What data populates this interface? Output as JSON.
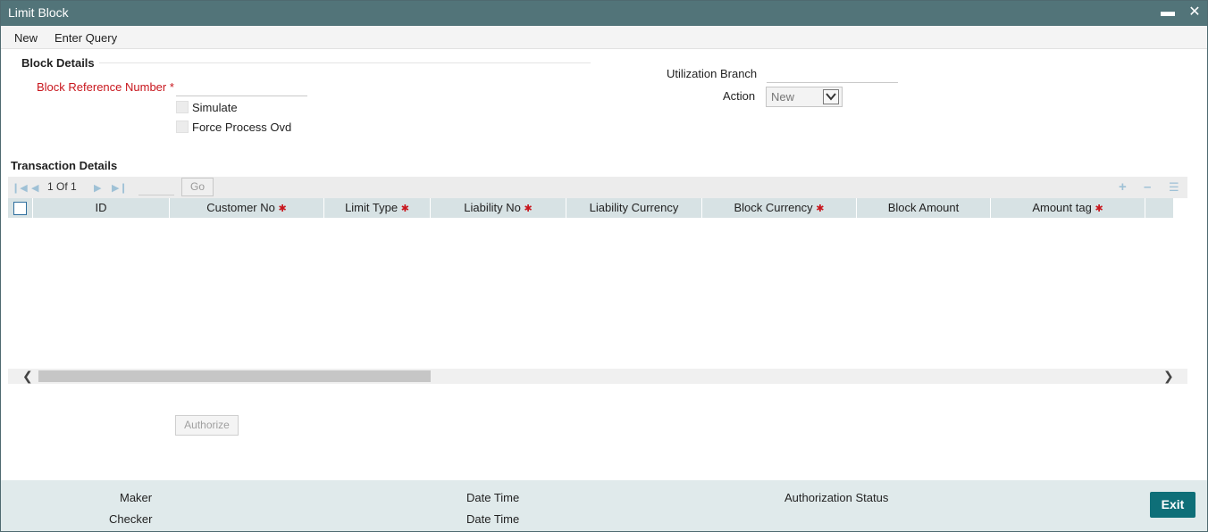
{
  "window": {
    "title": "Limit Block"
  },
  "menu": {
    "items": [
      "New",
      "Enter Query"
    ]
  },
  "block_details": {
    "title": "Block Details",
    "block_ref_label": "Block Reference Number",
    "required_marker": "*",
    "block_ref_value": "",
    "simulate_label": "Simulate",
    "force_process_label": "Force Process Ovd",
    "utilization_branch_label": "Utilization Branch",
    "utilization_branch_value": "",
    "action_label": "Action",
    "action_value": "New"
  },
  "transaction_details": {
    "title": "Transaction Details",
    "pager": "1 Of 1",
    "go_label": "Go",
    "columns": [
      {
        "label": "ID",
        "required": false
      },
      {
        "label": "Customer No",
        "required": true
      },
      {
        "label": "Limit Type",
        "required": true
      },
      {
        "label": "Liability No",
        "required": true
      },
      {
        "label": "Liability Currency",
        "required": false
      },
      {
        "label": "Block Currency",
        "required": true
      },
      {
        "label": "Block Amount",
        "required": false
      },
      {
        "label": "Amount tag",
        "required": true
      }
    ],
    "rows": []
  },
  "authorize_label": "Authorize",
  "footer": {
    "maker": "Maker",
    "checker": "Checker",
    "date_time_1": "Date Time",
    "date_time_2": "Date Time",
    "authorization_status": "Authorization Status",
    "exit_label": "Exit"
  },
  "colors": {
    "titlebar": "#527479",
    "exit_button": "#0e6f78",
    "required": "#c8161d",
    "grid_header": "#d7e2e4"
  },
  "icons": [
    "minimize-icon",
    "close-icon",
    "first-page-icon",
    "previous-page-icon",
    "next-page-icon",
    "last-page-icon",
    "add-row-icon",
    "delete-row-icon",
    "single-view-icon",
    "chevron-left-icon",
    "chevron-right-icon",
    "chevron-down-icon"
  ]
}
